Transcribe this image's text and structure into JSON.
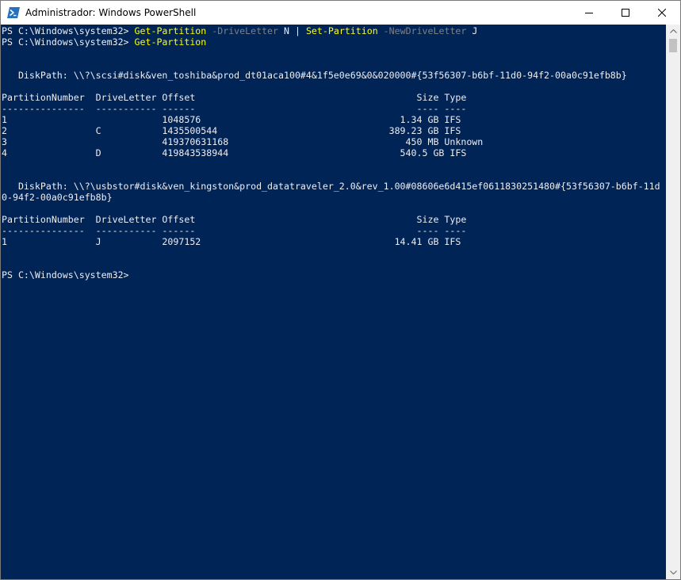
{
  "window": {
    "title": "Administrador: Windows PowerShell",
    "icon": "powershell-icon",
    "controls": [
      "minimize-icon",
      "maximize-icon",
      "close-icon"
    ]
  },
  "colors": {
    "console_bg": "#012456",
    "console_fg": "#eeedf0",
    "command": "#ffff00",
    "parameter": "#808080"
  },
  "console": {
    "cmd1": {
      "prompt": "PS C:\\Windows\\system32> ",
      "cmdlet1": "Get-Partition",
      "param1": " -DriveLetter",
      "arg1": " N",
      "pipe": " | ",
      "cmdlet2": "Set-Partition",
      "param2": " -NewDriveLetter",
      "arg2": " J"
    },
    "cmd2": {
      "prompt": "PS C:\\Windows\\system32> ",
      "cmdlet": "Get-Partition"
    },
    "disk1": {
      "path": "   DiskPath: \\\\?\\scsi#disk&ven_toshiba&prod_dt01aca100#4&1f5e0e69&0&020000#{53f56307-b6bf-11d0-94f2-00a0c91efb8b}",
      "header": "PartitionNumber  DriveLetter Offset                                        Size Type",
      "separator": "---------------  ----------- ------                                        ---- ----",
      "rows": [
        "1                            1048576                                    1.34 GB IFS",
        "2                C           1435500544                               389.23 GB IFS",
        "3                            419370631168                                450 MB Unknown",
        "4                D           419843538944                               540.5 GB IFS"
      ]
    },
    "disk2": {
      "path_line1": "   DiskPath: \\\\?\\usbstor#disk&ven_kingston&prod_datatraveler_2.0&rev_1.00#08606e6d415ef0611830251480#{53f56307-b6bf-11d",
      "path_line2": "0-94f2-00a0c91efb8b}",
      "header": "PartitionNumber  DriveLetter Offset                                        Size Type",
      "separator": "---------------  ----------- ------                                        ---- ----",
      "rows": [
        "1                J           2097152                                   14.41 GB IFS"
      ]
    },
    "final_prompt": "PS C:\\Windows\\system32>"
  },
  "scrollbar": {
    "up_icon": "scroll-up-arrow-icon",
    "down_icon": "scroll-down-arrow-icon"
  }
}
